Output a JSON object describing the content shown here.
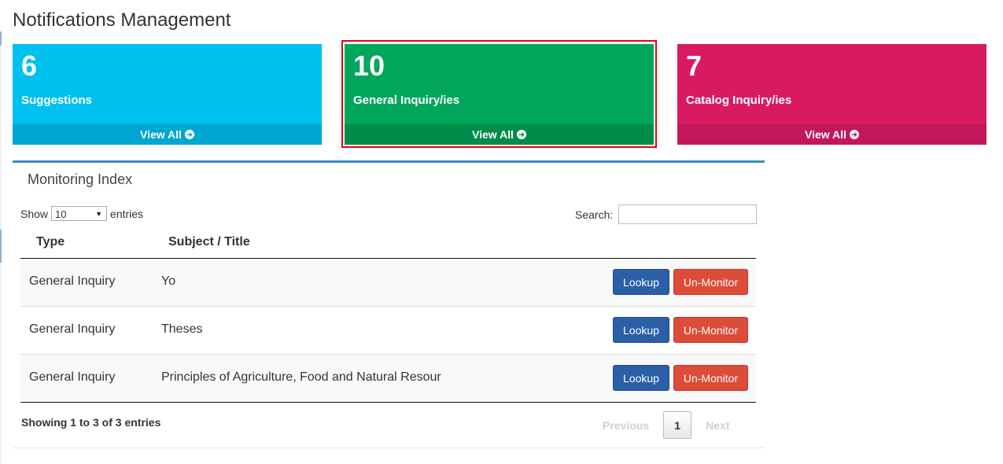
{
  "page": {
    "title": "Notifications Management"
  },
  "stat_boxes": [
    {
      "count": "6",
      "label": "Suggestions",
      "footer_label": "View All",
      "color": "#00c0ef"
    },
    {
      "count": "10",
      "label": "General Inquiry/ies",
      "footer_label": "View All",
      "color": "#00a65a",
      "highlighted": true
    },
    {
      "count": "7",
      "label": "Catalog Inquiry/ies",
      "footer_label": "View All",
      "color": "#d81b60"
    }
  ],
  "monitoring": {
    "title": "Monitoring Index",
    "show_label": "Show",
    "entries_value": "10",
    "entries_label": "entries",
    "search_label": "Search:",
    "search_value": "",
    "columns": [
      "Type",
      "Subject / Title"
    ],
    "rows": [
      {
        "type": "General Inquiry",
        "subject": "Yo",
        "lookup_label": "Lookup",
        "unmonitor_label": "Un-Monitor"
      },
      {
        "type": "General Inquiry",
        "subject": "Theses",
        "lookup_label": "Lookup",
        "unmonitor_label": "Un-Monitor"
      },
      {
        "type": "General Inquiry",
        "subject": "Principles of Agriculture, Food and Natural Resour",
        "lookup_label": "Lookup",
        "unmonitor_label": "Un-Monitor"
      }
    ],
    "showing_text": "Showing 1 to 3 of 3 entries",
    "pagination": {
      "previous": "Previous",
      "current_page": "1",
      "next": "Next"
    }
  },
  "colors": {
    "accent": "#3c8dbc",
    "lookup_button": "#2a5fa8",
    "unmonitor_button": "#dd4b39",
    "highlight_border": "#e8000b"
  },
  "icons": {
    "view_all": "arrow-circle-right-icon",
    "select_caret": "caret-down-icon"
  }
}
